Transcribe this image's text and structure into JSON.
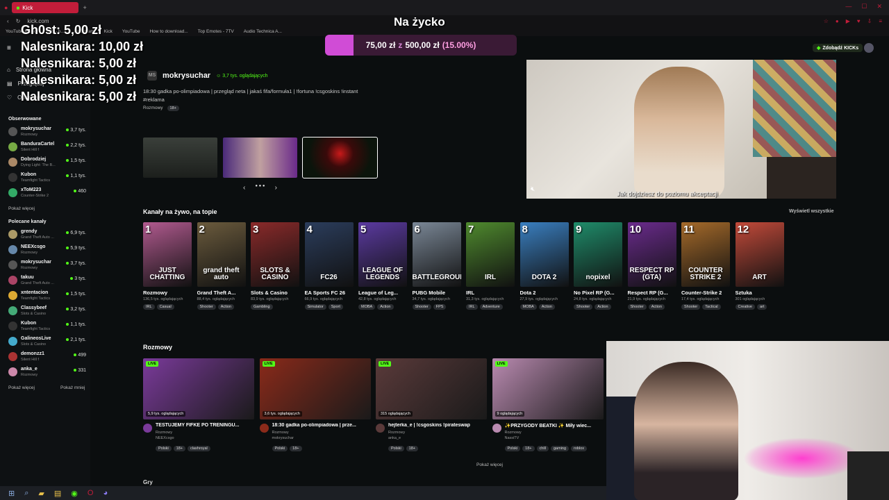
{
  "browser": {
    "tab_title": "Kick",
    "url": "kick.com",
    "bookmarks": [
      "YouTube Music",
      "(32) - b...",
      "Instagram",
      "Kick",
      "YouTube",
      "How to download...",
      "Top Emotes - 7TV",
      "Audio Technica A..."
    ]
  },
  "donations": [
    {
      "name": "Gh0st:",
      "amount": "5,00 zł"
    },
    {
      "name": "Nalesnikara:",
      "amount": "10,00 zł"
    },
    {
      "name": "Nalesnikara:",
      "amount": "5,00 zł"
    },
    {
      "name": "Nalesnikara:",
      "amount": "5,00 zł"
    },
    {
      "name": "Nalesnikara:",
      "amount": "5,00 zł"
    }
  ],
  "goal": {
    "title": "Na życko",
    "current": "75,00 zł",
    "separator": "z",
    "target": "500,00 zł",
    "percent_text": "(15.00%)",
    "progress": 0.15,
    "fill_color": "#d04cd6"
  },
  "sidebar": {
    "nav": [
      {
        "label": "Strona główna",
        "icon": "home-icon"
      },
      {
        "label": "Przeglądaj",
        "icon": "browse-icon"
      },
      {
        "label": "Obserwowane",
        "icon": "heart-icon"
      }
    ],
    "followed_title": "Obserwowane",
    "followed": [
      {
        "name": "mokrysuchar",
        "cat": "Rozmowy",
        "views": "3,7 tys.",
        "color": "#555"
      },
      {
        "name": "BanduraCartel",
        "cat": "Silent Hill f",
        "views": "2,2 tys.",
        "color": "#7a4"
      },
      {
        "name": "Dobrodziej",
        "cat": "Dying Light: The B...",
        "views": "1,5 tys.",
        "color": "#a86"
      },
      {
        "name": "Kubon",
        "cat": "Teamfight Tactics",
        "views": "1,1 tys.",
        "color": "#333"
      },
      {
        "name": "xToM223",
        "cat": "Counter-Strike 2",
        "views": "460",
        "color": "#3a6"
      }
    ],
    "followed_more": "Pokaż więcej",
    "recommended_title": "Polecane kanały",
    "recommended": [
      {
        "name": "grendy",
        "cat": "Grand Theft Auto ...",
        "views": "6,9 tys.",
        "color": "#a96"
      },
      {
        "name": "NEEXcsgo",
        "cat": "Rozmowy",
        "views": "5,9 tys.",
        "color": "#68a"
      },
      {
        "name": "mokrysuchar",
        "cat": "Rozmowy",
        "views": "3,7 tys.",
        "color": "#555"
      },
      {
        "name": "takuu",
        "cat": "Grand Theft Auto ...",
        "views": "3 tys.",
        "color": "#a46"
      },
      {
        "name": "xntentacion",
        "cat": "Teamfight Tactics",
        "views": "1,5 tys.",
        "color": "#da3"
      },
      {
        "name": "Classybeef",
        "cat": "Slots & Casino",
        "views": "3,2 tys.",
        "color": "#4a7"
      },
      {
        "name": "Kubon",
        "cat": "Teamfight Tactics",
        "views": "1,1 tys.",
        "color": "#333"
      },
      {
        "name": "GalineosLive",
        "cat": "Slots & Casino",
        "views": "2,1 tys.",
        "color": "#4ac"
      },
      {
        "name": "demonzz1",
        "cat": "Silent Hill f",
        "views": "499",
        "color": "#a33"
      },
      {
        "name": "anka_e",
        "cat": "Rozmowy",
        "views": "331",
        "color": "#c8a"
      }
    ],
    "rec_more": "Pokaż więcej",
    "rec_less": "Pokaż mniej"
  },
  "featured": {
    "channel": "mokrysuchar",
    "viewers": "3,7 tys. oglądających",
    "title": "18:30 gadka po-olimpiadowa | przegląd neta | jakaś fifa/formuła1 | !fortuna !csgoskins !instant #reklama",
    "category": "Rozmowy",
    "badge": "18+",
    "subtitle": "Jak dojdziesz do poziomu akceptacji"
  },
  "live_section": {
    "title": "Kanały na żywo, na topie",
    "see_all": "Wyświetl wszystkie",
    "categories": [
      {
        "rank": "1",
        "art": "JUST CHATTING",
        "name": "Rozmowy",
        "views": "136,5 tys. oglądających",
        "tags": [
          "IRL",
          "Casual"
        ],
        "bg": "#b15a8f"
      },
      {
        "rank": "2",
        "art": "grand theft auto",
        "name": "Grand Theft A...",
        "views": "88,4 tys. oglądających",
        "tags": [
          "Shooter",
          "Action"
        ],
        "bg": "#6b5b3d"
      },
      {
        "rank": "3",
        "art": "SLOTS & CASINO",
        "name": "Slots & Casino",
        "views": "83,9 tys. oglądających",
        "tags": [
          "Gambling"
        ],
        "bg": "#8a2a2a"
      },
      {
        "rank": "4",
        "art": "FC26",
        "name": "EA Sports FC 26",
        "views": "66,9 tys. oglądających",
        "tags": [
          "Simulator",
          "Sport"
        ],
        "bg": "#2b3d5c"
      },
      {
        "rank": "5",
        "art": "LEAGUE OF LEGENDS",
        "name": "League of Leg...",
        "views": "42,8 tys. oglądających",
        "tags": [
          "MOBA",
          "Action"
        ],
        "bg": "#5b3aa0"
      },
      {
        "rank": "6",
        "art": "BATTLEGROUNDS",
        "name": "PUBG Mobile",
        "views": "34,7 tys. oglądających",
        "tags": [
          "Shooter",
          "FPS"
        ],
        "bg": "#7a8796"
      },
      {
        "rank": "7",
        "art": "IRL",
        "name": "IRL",
        "views": "31,3 tys. oglądających",
        "tags": [
          "IRL",
          "Adventure"
        ],
        "bg": "#4f8a2e"
      },
      {
        "rank": "8",
        "art": "DOTA 2",
        "name": "Dota 2",
        "views": "27,9 tys. oglądających",
        "tags": [
          "MOBA",
          "Action"
        ],
        "bg": "#3a7fc0"
      },
      {
        "rank": "9",
        "art": "nopixel",
        "name": "No Pixel RP (G...",
        "views": "24,8 tys. oglądających",
        "tags": [
          "Shooter",
          "Action"
        ],
        "bg": "#1f8c6a"
      },
      {
        "rank": "10",
        "art": "RESPECT RP (GTA)",
        "name": "Respect RP (G...",
        "views": "21,9 tys. oglądających",
        "tags": [
          "Shooter",
          "Action"
        ],
        "bg": "#6a2b8c"
      },
      {
        "rank": "11",
        "art": "COUNTER STRIKE 2",
        "name": "Counter-Strike 2",
        "views": "17,4 tys. oglądających",
        "tags": [
          "Shooter",
          "Tactical"
        ],
        "bg": "#a56a2a"
      },
      {
        "rank": "12",
        "art": "ART",
        "name": "Sztuka",
        "views": "301 oglądających",
        "tags": [
          "Creative",
          "art"
        ],
        "bg": "#c24a3a"
      }
    ]
  },
  "rozmowy": {
    "title": "Rozmowy",
    "live_label": "LIVE",
    "streams": [
      {
        "viewers": "5,9 tys. oglądających",
        "title": "TESTUJEMY FIFKE PO TRENINGU...",
        "cat": "Rozmowy",
        "user": "NEEXcsgo",
        "tags": [
          "Polski",
          "18+",
          "clashroyal"
        ],
        "bg": "#7a3a9a"
      },
      {
        "viewers": "3,6 tys. oglądających",
        "title": "18:30 gadka po-olimpiadowa | prze...",
        "cat": "Rozmowy",
        "user": "mokrysuchar",
        "tags": [
          "Polski",
          "18+"
        ],
        "bg": "#8a2a1a"
      },
      {
        "viewers": "315 oglądających",
        "title": "hejterka_e | !csgoskins !pirateswap",
        "cat": "Rozmowy",
        "user": "anka_e",
        "tags": [
          "Polski",
          "18+"
        ],
        "bg": "#5a3a3a"
      },
      {
        "viewers": "9 oglądających",
        "title": "✨PRZYGODY BEATKI ✨ Miły wiec...",
        "cat": "Rozmowy",
        "user": "NassiTV",
        "tags": [
          "Polski",
          "18+",
          "chill",
          "gaming",
          "roblox"
        ],
        "bg": "#b98ab0"
      }
    ],
    "more": "Pokaż więcej",
    "next_section": "Gry"
  },
  "kicks_button": "Zdobądź KICKs"
}
